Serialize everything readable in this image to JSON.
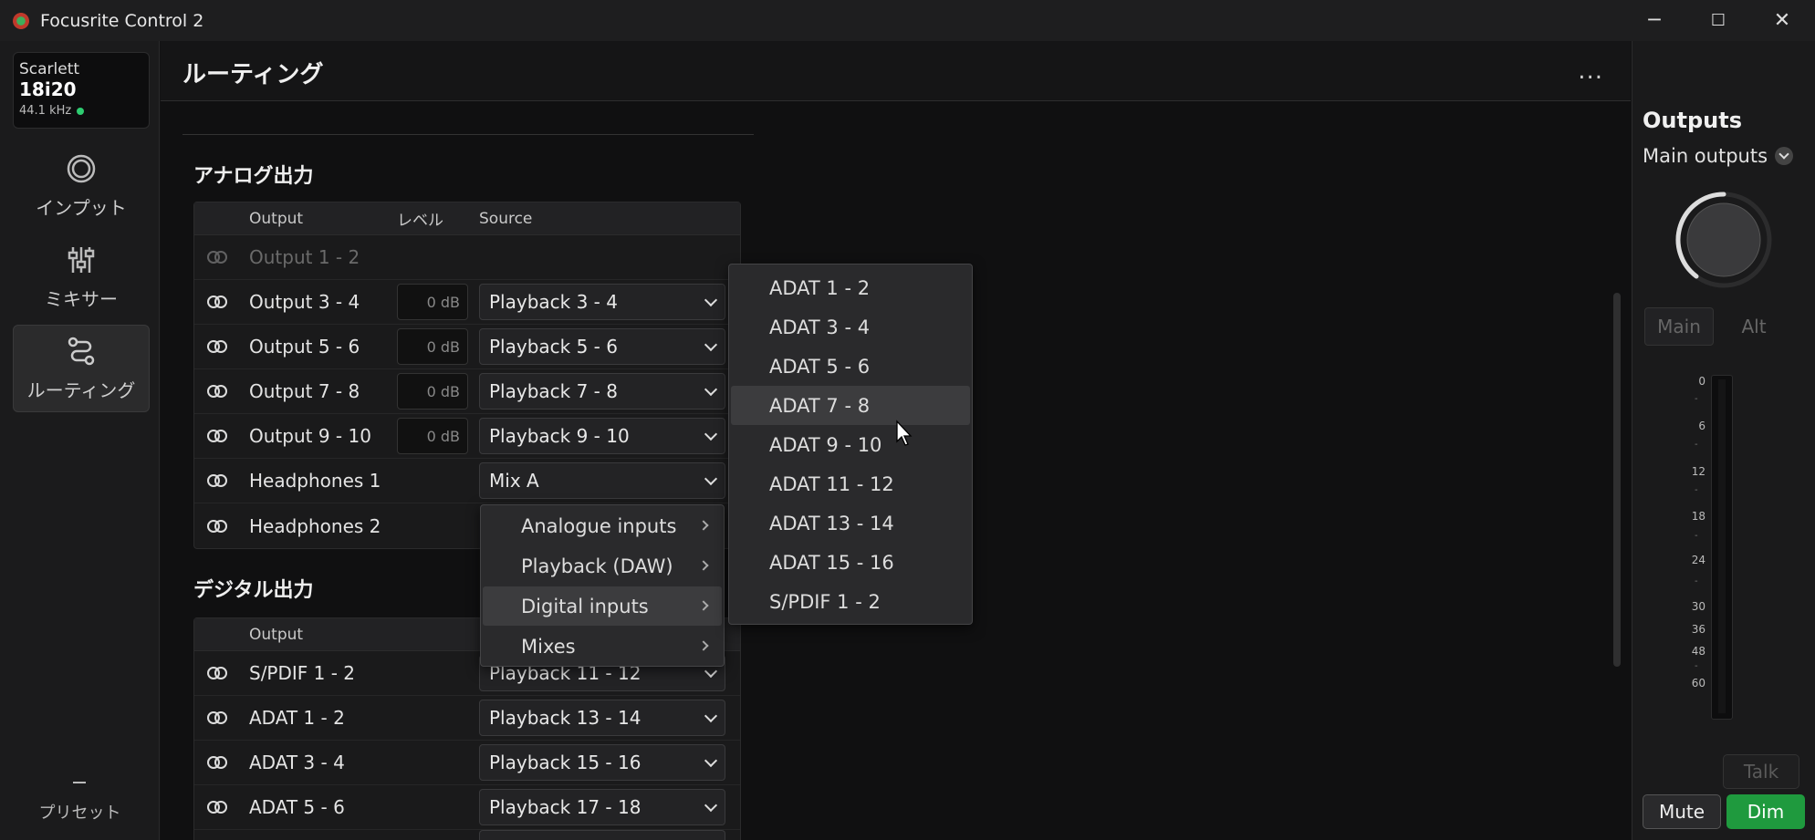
{
  "window": {
    "title": "Focusrite Control 2"
  },
  "device": {
    "brand": "Scarlett",
    "model": "18i20",
    "sample_rate": "44.1 kHz"
  },
  "nav": {
    "items": [
      {
        "label": "インプット",
        "icon": "inputs-icon"
      },
      {
        "label": "ミキサー",
        "icon": "mixer-icon"
      },
      {
        "label": "ルーティング",
        "icon": "routing-icon"
      }
    ],
    "active": "ルーティング",
    "preset_label": "プリセット"
  },
  "page": {
    "title": "ルーティング",
    "more": "..."
  },
  "analog": {
    "title": "アナログ出力",
    "headers": {
      "output": "Output",
      "level": "レベル",
      "source": "Source"
    },
    "rows": [
      {
        "name": "Output 1 - 2",
        "level": "",
        "source": ""
      },
      {
        "name": "Output 3 - 4",
        "level": "0 dB",
        "source": "Playback 3 - 4"
      },
      {
        "name": "Output 5 - 6",
        "level": "0 dB",
        "source": "Playback 5 - 6"
      },
      {
        "name": "Output 7 - 8",
        "level": "0 dB",
        "source": "Playback 7 - 8"
      },
      {
        "name": "Output 9 - 10",
        "level": "0 dB",
        "source": "Playback 9 - 10"
      },
      {
        "name": "Headphones 1",
        "level": "",
        "source": "Mix A"
      },
      {
        "name": "Headphones 2",
        "level": "",
        "source": ""
      }
    ]
  },
  "digital": {
    "title": "デジタル出力",
    "headers": {
      "output": "Output"
    },
    "rows": [
      {
        "name": "S/PDIF 1 - 2",
        "source": "Playback 11 - 12"
      },
      {
        "name": "ADAT 1 - 2",
        "source": "Playback 13 - 14"
      },
      {
        "name": "ADAT 3 - 4",
        "source": "Playback 15 - 16"
      },
      {
        "name": "ADAT 5 - 6",
        "source": "Playback 17 - 18"
      }
    ]
  },
  "source_menu": {
    "items": [
      "Analogue inputs",
      "Playback (DAW)",
      "Digital inputs",
      "Mixes"
    ],
    "highlighted": "Digital inputs"
  },
  "digital_submenu": {
    "items": [
      "ADAT 1 - 2",
      "ADAT 3 - 4",
      "ADAT 5 - 6",
      "ADAT 7 - 8",
      "ADAT 9 - 10",
      "ADAT 11 - 12",
      "ADAT 13 - 14",
      "ADAT 15 - 16",
      "S/PDIF 1 - 2"
    ],
    "highlighted": "ADAT 7 - 8"
  },
  "outputs_panel": {
    "title": "Outputs",
    "selector": "Main outputs",
    "main_label": "Main",
    "alt_label": "Alt",
    "meter_ticks": [
      "0",
      "6",
      "12",
      "18",
      "24",
      "30",
      "36",
      "48",
      "60"
    ],
    "talk_label": "Talk",
    "mute_label": "Mute",
    "dim_label": "Dim",
    "dim_color": "#1f9a3e"
  }
}
